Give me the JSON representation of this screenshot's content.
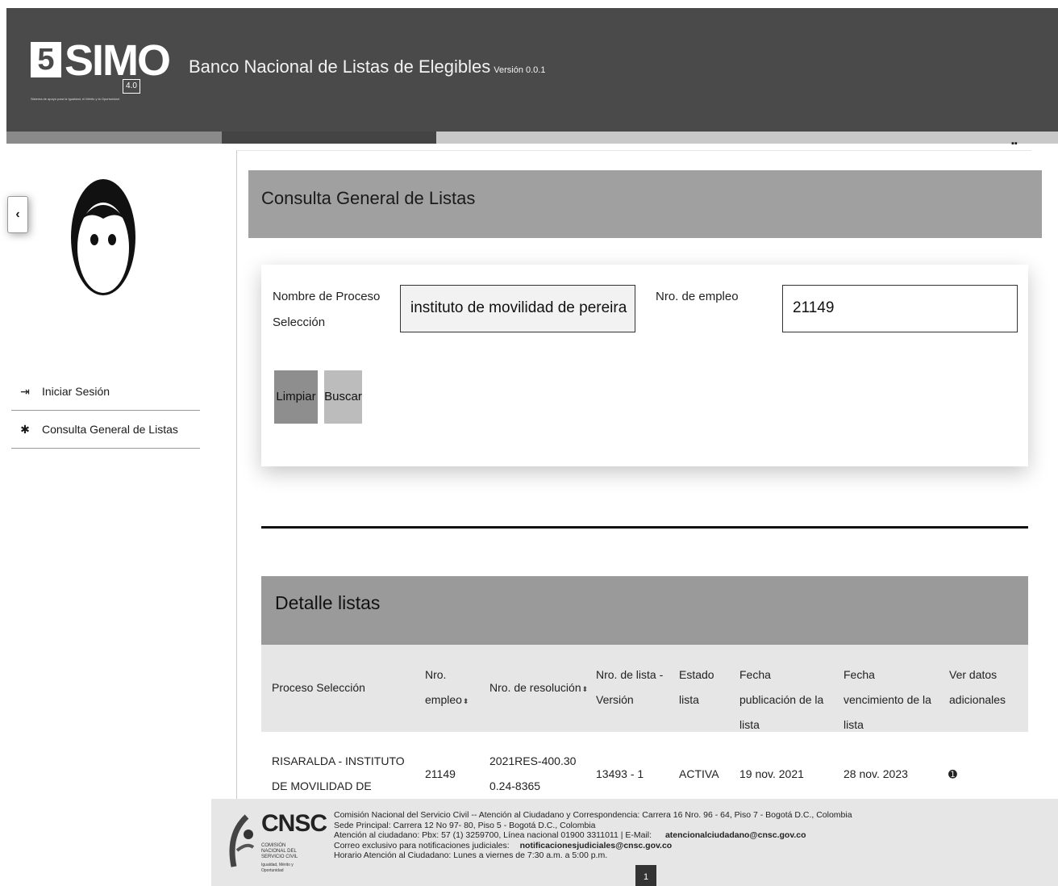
{
  "header": {
    "logo_text": "SIMO",
    "logo_version": "4.0",
    "logo_tagline": "Sistema de apoyo para la Igualdad, el Mérito y la Oportunidad",
    "app_title": "Banco Nacional de Listas de Elegibles",
    "app_version": "Versión 0.0.1"
  },
  "sidebar": {
    "items": [
      {
        "icon": "login-icon",
        "label": "Iniciar Sesión"
      },
      {
        "icon": "asterisk-icon",
        "label": "Consulta General de Listas"
      }
    ]
  },
  "page": {
    "title": "Consulta General de Listas"
  },
  "form": {
    "proceso_label": "Nombre de Proceso Selección",
    "proceso_value": "instituto de movilidad de pereira",
    "empleo_label": "Nro. de empleo",
    "empleo_value": "21149",
    "limpiar_label": "Limpiar",
    "buscar_label": "Buscar"
  },
  "detalle": {
    "title": "Detalle listas",
    "columns": [
      "Proceso Selección",
      "Nro. empleo",
      "Nro. de resolución",
      "Nro. de lista - Versión",
      "Estado lista",
      "Fecha publicación de la lista",
      "Fecha vencimiento de la lista",
      "Ver datos adicionales"
    ],
    "rows": [
      {
        "proceso": "RISARALDA - INSTITUTO DE MOVILIDAD DE PEREIRA",
        "empleo": "21149",
        "resolucion": "2021RES-400.300.24-8365",
        "lista_version": "13493 - 1",
        "estado": "ACTIVA",
        "fecha_publicacion": "19 nov. 2021",
        "fecha_vencimiento": "28 nov. 2023"
      }
    ]
  },
  "footer": {
    "logo_text": "CNSC",
    "logo_sub": "COMISIÓN NACIONAL DEL SERVICIO CIVIL",
    "logo_tag": "Igualdad, Mérito y Oportunidad",
    "line1": "Comisión Nacional del Servicio Civil -- Atención al Ciudadano y Correspondencia: Carrera 16 Nro. 96 - 64, Piso 7 - Bogotá D.C., Colombia",
    "line2": "Sede Principal: Carrera 12 No 97- 80, Piso 5 - Bogotá D.C., Colombia",
    "line3_prefix": "Atención al ciudadano: Pbx: 57 (1) 3259700, Línea nacional 01900 3311011 | E-Mail:",
    "line3_email": "atencionalciudadano@cnsc.gov.co",
    "line4_prefix": "Correo exclusivo para notificaciones judiciales:",
    "line4_email": "notificacionesjudiciales@cnsc.gov.co",
    "line5": "Horario Atención al Ciudadano: Lunes a viernes de 7:30 a.m. a 5:00 p.m.",
    "page_number": "1"
  },
  "colors": {
    "header_bg": "#4a4a4a",
    "title_bar_bg": "#a0a0a0",
    "table_header_bg": "#e6e6e6",
    "footer_bg": "#e6e6e6"
  }
}
